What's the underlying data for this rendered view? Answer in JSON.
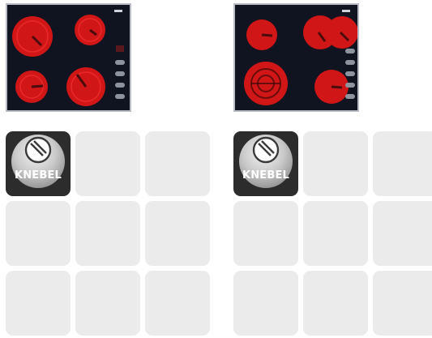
{
  "colors": {
    "hob_background": "#101320",
    "hob_border": "#b9bcc4",
    "burner_red": "#e01818",
    "tile_empty": "#ebebeb",
    "tile_knob": "#2c2c2c"
  },
  "hobs": [
    {
      "name": "hob-left"
    },
    {
      "name": "hob-right"
    }
  ],
  "panels": {
    "left": {
      "knob_tile": {
        "icon": "knob-icon",
        "label": "KNEBEL"
      }
    },
    "right": {
      "knob_tile": {
        "icon": "knob-icon",
        "label": "KNEBEL"
      }
    }
  }
}
